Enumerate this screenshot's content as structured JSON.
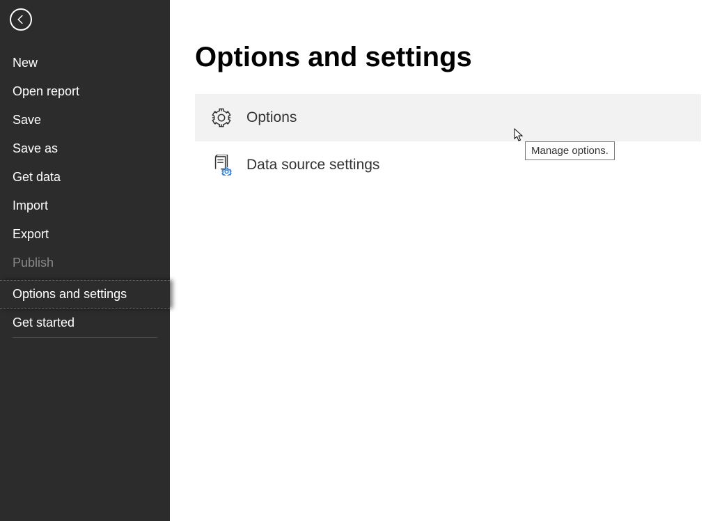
{
  "sidebar": {
    "items": [
      {
        "label": "New"
      },
      {
        "label": "Open report"
      },
      {
        "label": "Save"
      },
      {
        "label": "Save as"
      },
      {
        "label": "Get data"
      },
      {
        "label": "Import"
      },
      {
        "label": "Export"
      },
      {
        "label": "Publish"
      },
      {
        "label": "Options and settings"
      },
      {
        "label": "Get started"
      }
    ]
  },
  "main": {
    "title": "Options and settings",
    "options": [
      {
        "label": "Options"
      },
      {
        "label": "Data source settings"
      }
    ]
  },
  "tooltip": "Manage options."
}
